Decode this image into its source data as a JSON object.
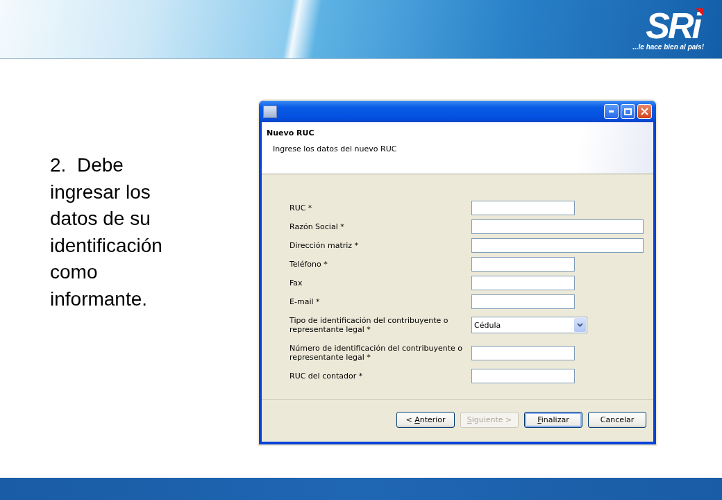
{
  "logo": {
    "mark": "SRi",
    "tagline": "...le hace bien al país!"
  },
  "slide_text": "2.  Debe ingresar los datos de su identificación como informante.",
  "dialog": {
    "heading": "Nuevo RUC",
    "subheading": "Ingrese los datos del nuevo RUC",
    "fields": [
      {
        "label": "RUC *",
        "kind": "text"
      },
      {
        "label": "Razón Social *",
        "kind": "longtext"
      },
      {
        "label": "Dirección matriz *",
        "kind": "longtext"
      },
      {
        "label": "Teléfono *",
        "kind": "text"
      },
      {
        "label": "Fax",
        "kind": "text"
      },
      {
        "label": "E-mail *",
        "kind": "text"
      },
      {
        "label": "Tipo de identificación del contribuyente o representante legal *",
        "kind": "select",
        "value": "Cédula"
      },
      {
        "label": "Número de identificación del contribuyente o representante legal *",
        "kind": "text"
      },
      {
        "label": "RUC del contador *",
        "kind": "text"
      }
    ],
    "buttons": [
      {
        "before": "< ",
        "key": "A",
        "after": "nterior",
        "disabled": false,
        "default": false
      },
      {
        "key": "S",
        "after": "iguiente >",
        "disabled": true,
        "default": false
      },
      {
        "key": "F",
        "after": "inalizar",
        "disabled": false,
        "default": true
      },
      {
        "after": "Cancelar",
        "disabled": false,
        "default": false
      }
    ]
  }
}
